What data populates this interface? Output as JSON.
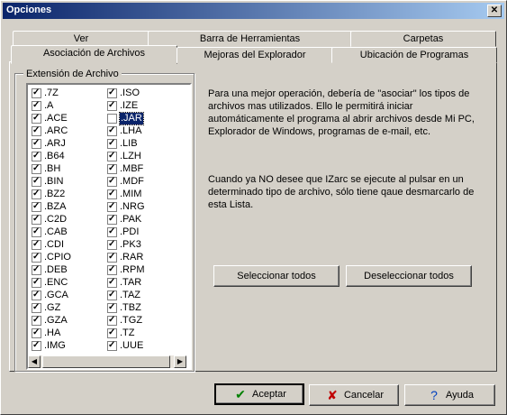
{
  "window": {
    "title": "Opciones",
    "close": "✕"
  },
  "tabs": {
    "row_back": [
      "Ver",
      "Barra de Herramientas",
      "Carpetas"
    ],
    "row_front": [
      "Asociación de Archivos",
      "Mejoras del Explorador",
      "Ubicación de Programas"
    ]
  },
  "group": {
    "label": "Extensión de Archivo"
  },
  "extensions_left": [
    ".7Z",
    ".A",
    ".ACE",
    ".ARC",
    ".ARJ",
    ".B64",
    ".BH",
    ".BIN",
    ".BZ2",
    ".BZA",
    ".C2D",
    ".CAB",
    ".CDI",
    ".CPIO",
    ".DEB",
    ".ENC",
    ".GCA",
    ".GZ",
    ".GZA",
    ".HA",
    ".IMG"
  ],
  "extensions_right": [
    ".ISO",
    ".IZE",
    ".JAR",
    ".LHA",
    ".LIB",
    ".LZH",
    ".MBF",
    ".MDF",
    ".MIM",
    ".NRG",
    ".PAK",
    ".PDI",
    ".PK3",
    ".RAR",
    ".RPM",
    ".TAR",
    ".TAZ",
    ".TBZ",
    ".TGZ",
    ".TZ",
    ".UUE"
  ],
  "unchecked": [
    ".JAR"
  ],
  "selected": ".JAR",
  "info": {
    "p1": "Para una mejor operación, debería de \"asociar\" los tipos de archivos mas utilizados. Ello le permitirá iniciar automáticamente el programa al abrir archivos desde Mi PC, Explorador de Windows, programas de e-mail, etc.",
    "p2": "Cuando ya NO desee que IZarc se ejecute al pulsar en un determinado tipo de archivo, sólo tiene qaue desmarcarlo de esta Lista."
  },
  "buttons": {
    "select_all": "Seleccionar todos",
    "deselect_all": "Deseleccionar todos",
    "accept": "Aceptar",
    "cancel": "Cancelar",
    "help": "Ayuda"
  },
  "icons": {
    "accept": "check-icon",
    "cancel": "x-icon",
    "help": "question-icon"
  },
  "colors": {
    "accept_icon": "#008000",
    "cancel_icon": "#c00000",
    "help_icon": "#0040c0"
  }
}
